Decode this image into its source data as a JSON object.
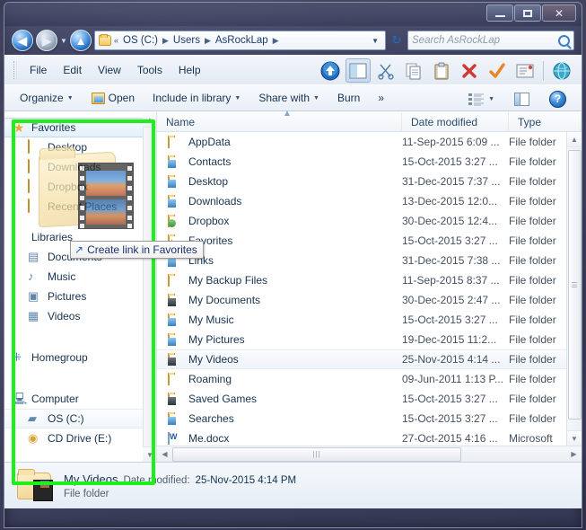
{
  "window": {
    "controls": {
      "minimize": "minimize-button",
      "maximize": "maximize-button",
      "close": "✕"
    }
  },
  "address_bar": {
    "back_label": "◀",
    "forward_label": "▶",
    "up_label": "▲",
    "overflow": "«",
    "crumbs": [
      "OS (C:)",
      "Users",
      "AsRockLap"
    ],
    "separator": "▶",
    "dropdown_caret": "▼",
    "refresh_label": "↻",
    "search_placeholder": "Search AsRockLap"
  },
  "menubar": {
    "items": [
      "File",
      "Edit",
      "View",
      "Tools",
      "Help"
    ],
    "icons": [
      "up-arrow-icon",
      "preview-pane-icon",
      "cut-scissors-icon",
      "copy-icon",
      "paste-icon",
      "delete-x-icon",
      "check-mark-icon",
      "rename-icon",
      "globe-icon"
    ]
  },
  "commandbar": {
    "organize": "Organize",
    "open": "Open",
    "include": "Include in library",
    "share": "Share with",
    "burn": "Burn",
    "more": "»",
    "caret": "▼",
    "help": "?"
  },
  "navpane": {
    "groups": [
      {
        "name": "Favorites",
        "icon": "star-icon",
        "selected": true,
        "children": [
          {
            "label": "Desktop",
            "icon": "desktop-folder-icon"
          },
          {
            "label": "Downloads",
            "icon": "downloads-folder-icon"
          },
          {
            "label": "Dropbox",
            "icon": "dropbox-folder-icon"
          },
          {
            "label": "Recent Places",
            "icon": "recent-places-icon"
          }
        ]
      },
      {
        "name": "Libraries",
        "icon": "libraries-icon",
        "children": [
          {
            "label": "Documents",
            "icon": "documents-library-icon"
          },
          {
            "label": "Music",
            "icon": "music-library-icon"
          },
          {
            "label": "Pictures",
            "icon": "pictures-library-icon"
          },
          {
            "label": "Videos",
            "icon": "videos-library-icon"
          }
        ]
      },
      {
        "name": "Homegroup",
        "icon": "homegroup-icon",
        "children": []
      },
      {
        "name": "Computer",
        "icon": "computer-icon",
        "children": [
          {
            "label": "OS (C:)",
            "icon": "hard-disk-icon",
            "hover": true
          },
          {
            "label": "CD Drive (E:)",
            "icon": "cd-drive-icon"
          }
        ]
      }
    ]
  },
  "drag": {
    "tooltip": "Create link in Favorites",
    "ghost_item": "My Videos"
  },
  "filelist": {
    "columns": [
      "Name",
      "Date modified",
      "Type"
    ],
    "rows": [
      {
        "name": "AppData",
        "date": "11-Sep-2015 6:09 ...",
        "type": "File folder",
        "icon": "folder-plain-icon"
      },
      {
        "name": "Contacts",
        "date": "15-Oct-2015 3:27 ...",
        "type": "File folder",
        "icon": "folder-contacts-icon"
      },
      {
        "name": "Desktop",
        "date": "31-Dec-2015 7:37 ...",
        "type": "File folder",
        "icon": "folder-desktop-icon"
      },
      {
        "name": "Downloads",
        "date": "13-Dec-2015 12:0...",
        "type": "File folder",
        "icon": "folder-downloads-icon"
      },
      {
        "name": "Dropbox",
        "date": "30-Dec-2015 12:4...",
        "type": "File folder",
        "icon": "folder-dropbox-icon"
      },
      {
        "name": "Favorites",
        "date": "15-Oct-2015 3:27 ...",
        "type": "File folder",
        "icon": "folder-favorites-icon"
      },
      {
        "name": "Links",
        "date": "31-Dec-2015 7:38 ...",
        "type": "File folder",
        "icon": "folder-links-icon"
      },
      {
        "name": "My Backup Files",
        "date": "11-Sep-2015 8:37 ...",
        "type": "File folder",
        "icon": "folder-plain-icon"
      },
      {
        "name": "My Documents",
        "date": "30-Dec-2015 2:47 ...",
        "type": "File folder",
        "icon": "folder-documents-icon"
      },
      {
        "name": "My Music",
        "date": "15-Oct-2015 3:27 ...",
        "type": "File folder",
        "icon": "folder-music-icon"
      },
      {
        "name": "My Pictures",
        "date": "19-Dec-2015 11:2...",
        "type": "File folder",
        "icon": "folder-pictures-icon"
      },
      {
        "name": "My Videos",
        "date": "25-Nov-2015 4:14 ...",
        "type": "File folder",
        "icon": "folder-videos-icon",
        "selected": true
      },
      {
        "name": "Roaming",
        "date": "09-Jun-2011 1:13 P...",
        "type": "File folder",
        "icon": "folder-plain-icon"
      },
      {
        "name": "Saved Games",
        "date": "15-Oct-2015 3:27 ...",
        "type": "File folder",
        "icon": "folder-savedgames-icon"
      },
      {
        "name": "Searches",
        "date": "15-Oct-2015 3:27 ...",
        "type": "File folder",
        "icon": "folder-searches-icon"
      },
      {
        "name": "Me.docx",
        "date": "27-Oct-2015 4:16 ...",
        "type": "Microsoft",
        "icon": "word-document-icon"
      }
    ]
  },
  "details_pane": {
    "name": "My Videos",
    "date_label": "Date modified:",
    "date_value": "25-Nov-2015 4:14 PM",
    "type": "File folder"
  },
  "colors": {
    "annotation_green": "#1bf019",
    "link_blue": "#17306c",
    "folder_yellow": "#f3c863"
  }
}
